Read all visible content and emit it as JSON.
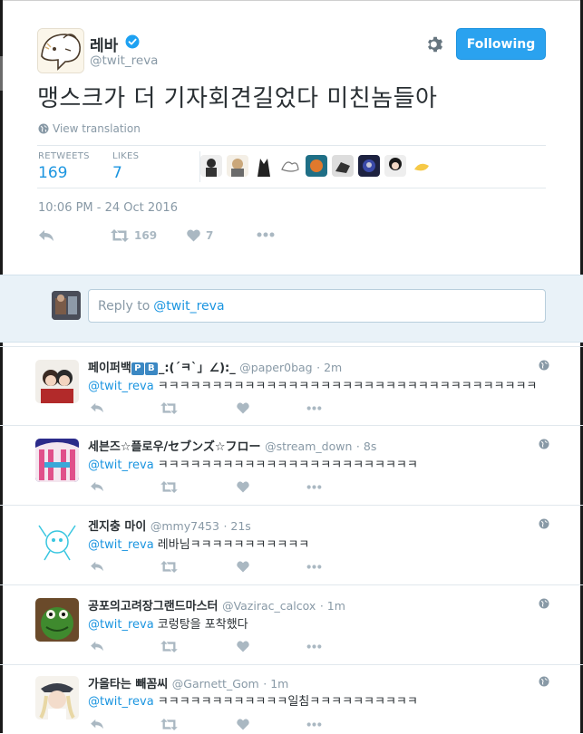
{
  "tweet": {
    "author_name": "레바",
    "author_handle": "@twit_reva",
    "follow_label": "Following",
    "text": "맹스크가 더 기자회견길었다 미친놈들아",
    "translate_label": "View translation",
    "retweets_label": "RETWEETS",
    "retweets_count": "169",
    "likes_label": "LIKES",
    "likes_count": "7",
    "timestamp": "10:06 PM - 24 Oct 2016",
    "action_retweet_count": "169",
    "action_like_count": "7"
  },
  "reply_box": {
    "placeholder_prefix": "Reply to",
    "mention": "@twit_reva"
  },
  "replies": [
    {
      "name": "페이퍼백",
      "name_suffix": "_:(´ㅋ`」∠):_",
      "badges": [
        "P",
        "B"
      ],
      "handle": "@paper0bag",
      "time": "· 2m",
      "mention": "@twit_reva",
      "text": "ㅋㅋㅋㅋㅋㅋㅋㅋㅋㅋㅋㅋㅋㅋㅋㅋㅋㅋㅋㅋㅋㅋㅋㅋㅋㅋㅋㅋㅋㅋㅋㅋㅋㅋㅋ"
    },
    {
      "name": "세븐즈☆플로우/セブンズ☆フロー",
      "handle": "@stream_down",
      "time": "· 8s",
      "mention": "@twit_reva",
      "text": "ㅋㅋㅋㅋㅋㅋㅋㅋㅋㅋㅋㅋㅋㅋㅋㅋㅋㅋㅋㅋㅋㅋㅋㅋ"
    },
    {
      "name": "겐지충 마이",
      "handle": "@mmy7453",
      "time": "· 21s",
      "mention": "@twit_reva",
      "text": "레바님ㅋㅋㅋㅋㅋㅋㅋㅋㅋㅋㅋ"
    },
    {
      "name": "공포의고려장그랜드마스터",
      "handle": "@Vazirac_calcox",
      "time": "· 1m",
      "mention": "@twit_reva",
      "text": "코렁탕을 포착했다"
    },
    {
      "name": "가을타는 빼꼼씨",
      "handle": "@Garnett_Gom",
      "time": "· 1m",
      "mention": "@twit_reva",
      "text": "ㅋㅋㅋㅋㅋㅋㅋㅋㅋㅋㅋㅋ일침ㅋㅋㅋㅋㅋㅋㅋㅋㅋㅋ"
    }
  ],
  "colors": {
    "accent": "#1b95e0",
    "follow_button": "#2aa2ef",
    "muted": "#8899a6",
    "reply_area_bg": "#e9f2f8"
  },
  "icons": {
    "verified": "verified-badge-icon",
    "settings": "gear-icon",
    "reply": "reply-arrow-icon",
    "retweet": "retweet-icon",
    "like": "heart-icon",
    "more": "more-dots-icon",
    "globe": "globe-icon"
  }
}
